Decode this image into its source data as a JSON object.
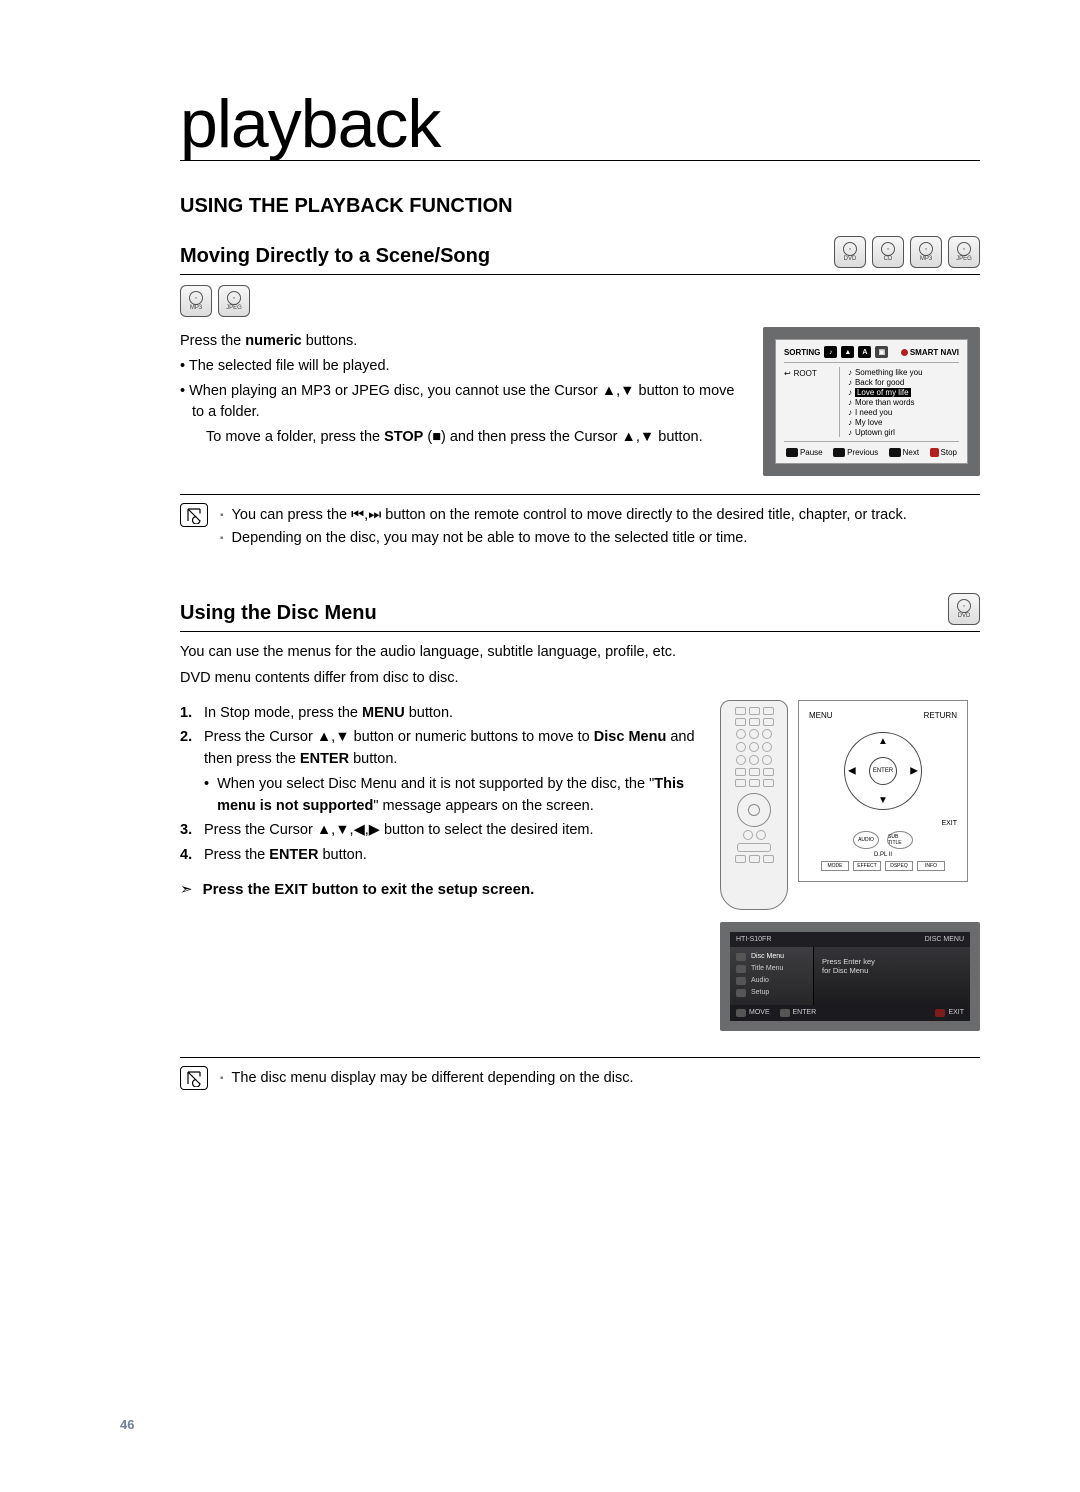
{
  "page": {
    "title": "playback",
    "number": "46"
  },
  "section": {
    "title": "USING THE PLAYBACK FUNCTION"
  },
  "moving": {
    "title": "Moving Directly to a Scene/Song",
    "top_badges": [
      "DVD",
      "CD",
      "MP3",
      "JPEG"
    ],
    "inline_badges": [
      "MP3",
      "JPEG"
    ],
    "intro_prefix": "Press the ",
    "intro_bold": "numeric",
    "intro_suffix": " buttons.",
    "b1": "The selected file will be played.",
    "b2a": "When playing an MP3 or JPEG disc, you cannot use the Cursor ",
    "b2_sym": "▲,▼",
    "b2b": " button to move to a folder.",
    "b3a": "To move a folder, press the ",
    "b3_stop": "STOP",
    "b3b": " (",
    "b3_sq": "■",
    "b3c": ") and then press the Cursor ",
    "b3_sym": "▲,▼",
    "b3d": " button."
  },
  "sorting_screen": {
    "label": "SORTING",
    "smartnavi": "SMART NAVI",
    "root": "ROOT",
    "songs": [
      "Something like you",
      "Back for good",
      "Love of my life",
      "More than words",
      "I need you",
      "My love",
      "Uptown girl"
    ],
    "selected_index": 2,
    "foot": {
      "pause": "Pause",
      "previous": "Previous",
      "next": "Next",
      "stop": "Stop"
    }
  },
  "note1": {
    "a_pre": "You can press the ",
    "a_sym": "⏮,⏭",
    "a_post": " button on the remote control to move directly to the desired title, chapter, or track.",
    "b": "Depending on the disc, you may not be able to move to the selected title or time."
  },
  "discmenu": {
    "title": "Using the Disc Menu",
    "top_badges": [
      "DVD"
    ],
    "p1": "You can use the menus for the audio language, subtitle language, profile, etc.",
    "p2": "DVD menu contents differ from disc to disc.",
    "s1_pre": "In Stop mode, press the ",
    "s1_bold": "MENU",
    "s1_post": " button.",
    "s2_pre": "Press the Cursor ",
    "s2_sym": "▲,▼",
    "s2_mid": " button or numeric buttons to move to ",
    "s2_bold1": "Disc Menu",
    "s2_mid2": " and then press the ",
    "s2_bold2": "ENTER",
    "s2_post": " button.",
    "s2_sub_pre": "When you select Disc Menu and it is not supported by the disc, the \"",
    "s2_sub_bold": "This menu is not supported",
    "s2_sub_post": "\" message appears on the screen.",
    "s3_pre": "Press the Cursor ",
    "s3_sym": "▲,▼,◀,▶",
    "s3_post": " button to select the desired item.",
    "s4_pre": "Press the ",
    "s4_bold": "ENTER",
    "s4_post": " button.",
    "exit_hint": "Press the EXIT button to exit the setup screen."
  },
  "remote_zoom": {
    "menu": "MENU",
    "ret": "RETURN",
    "enter": "ENTER",
    "exit": "EXIT",
    "audio": "AUDIO",
    "subtitle": "SUB TITLE",
    "pl2": "D.PL II",
    "row": [
      "MODE",
      "EFFECT",
      "DSPEQ",
      "INFO"
    ]
  },
  "osd": {
    "head_left": "HTI-S10FR",
    "head_right": "DISC MENU",
    "side": [
      "Disc Menu",
      "Title Menu",
      "Audio",
      "Setup"
    ],
    "main1": "Press Enter key",
    "main2": "for Disc Menu",
    "foot_move": "MOVE",
    "foot_enter": "ENTER",
    "foot_exit": "EXIT"
  },
  "note2": {
    "text": "The disc menu display may be different depending on the disc."
  }
}
